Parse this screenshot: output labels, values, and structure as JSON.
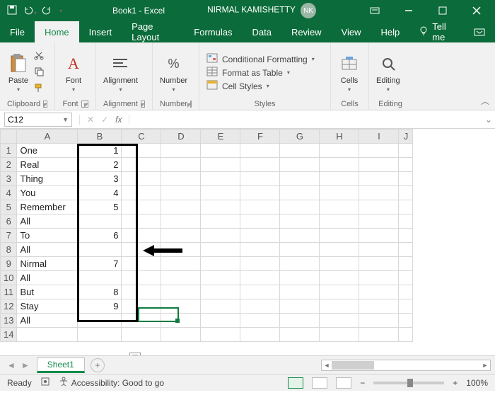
{
  "titlebar": {
    "doc_title": "Book1 - Excel",
    "user_name": "NIRMAL KAMISHETTY",
    "user_initials": "NK"
  },
  "tabs": {
    "file": "File",
    "home": "Home",
    "insert": "Insert",
    "page_layout": "Page Layout",
    "formulas": "Formulas",
    "data": "Data",
    "review": "Review",
    "view": "View",
    "help": "Help",
    "tell_me": "Tell me"
  },
  "ribbon": {
    "clipboard": {
      "paste": "Paste",
      "label": "Clipboard"
    },
    "font": {
      "big": "Font",
      "label": "Font"
    },
    "alignment": {
      "big": "Alignment",
      "label": "Alignment"
    },
    "number": {
      "big": "Number",
      "label": "Number"
    },
    "styles": {
      "cond": "Conditional Formatting",
      "tbl": "Format as Table",
      "cell": "Cell Styles",
      "label": "Styles"
    },
    "cells": {
      "big": "Cells",
      "label": "Cells"
    },
    "editing": {
      "big": "Editing",
      "label": "Editing"
    }
  },
  "fxbar": {
    "namebox": "C12",
    "fx": "fx",
    "cancel": "✕",
    "enter": "✓"
  },
  "columns": [
    "A",
    "B",
    "C",
    "D",
    "E",
    "F",
    "G",
    "H",
    "I",
    "J"
  ],
  "rows": [
    {
      "n": "1",
      "a": "One",
      "b": "1"
    },
    {
      "n": "2",
      "a": "Real",
      "b": "2"
    },
    {
      "n": "3",
      "a": "Thing",
      "b": "3"
    },
    {
      "n": "4",
      "a": "You",
      "b": "4"
    },
    {
      "n": "5",
      "a": "Remember",
      "b": "5"
    },
    {
      "n": "6",
      "a": "All",
      "b": ""
    },
    {
      "n": "7",
      "a": "To",
      "b": "6"
    },
    {
      "n": "8",
      "a": "All",
      "b": ""
    },
    {
      "n": "9",
      "a": "Nirmal",
      "b": "7"
    },
    {
      "n": "10",
      "a": "All",
      "b": ""
    },
    {
      "n": "11",
      "a": "But",
      "b": "8"
    },
    {
      "n": "12",
      "a": "Stay",
      "b": "9"
    },
    {
      "n": "13",
      "a": "All",
      "b": ""
    },
    {
      "n": "14",
      "a": "",
      "b": ""
    }
  ],
  "sheet_tab": "Sheet1",
  "status": {
    "ready": "Ready",
    "access": "Accessibility: Good to go",
    "zoom": "100%"
  }
}
